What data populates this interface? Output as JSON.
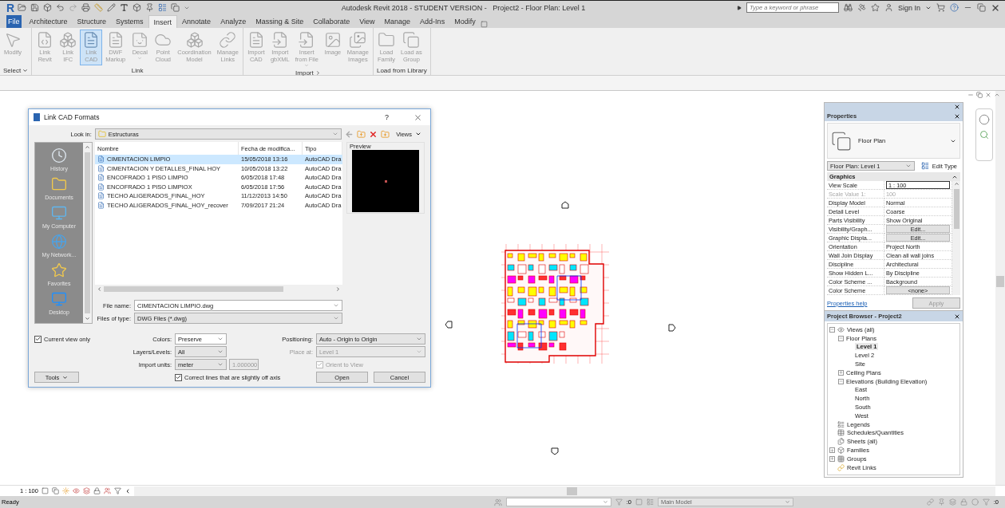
{
  "app_logo": "R",
  "window": {
    "title": "Autodesk Revit 2018 - STUDENT VERSION -   Project2 - Floor Plan: Level 1"
  },
  "search": {
    "placeholder": "Type a keyword or phrase"
  },
  "account": {
    "label": "Sign In"
  },
  "ribbon": {
    "tabs": [
      {
        "label": "File",
        "kind": "app",
        "selected": false
      },
      {
        "label": "Architecture",
        "kind": "tab",
        "selected": false
      },
      {
        "label": "Structure",
        "kind": "tab",
        "selected": false
      },
      {
        "label": "Systems",
        "kind": "tab",
        "selected": false
      },
      {
        "label": "Insert",
        "kind": "tab",
        "selected": true
      },
      {
        "label": "Annotate",
        "kind": "tab",
        "selected": false
      },
      {
        "label": "Analyze",
        "kind": "tab",
        "selected": false
      },
      {
        "label": "Massing & Site",
        "kind": "tab",
        "selected": false
      },
      {
        "label": "Collaborate",
        "kind": "tab",
        "selected": false
      },
      {
        "label": "View",
        "kind": "tab",
        "selected": false
      },
      {
        "label": "Manage",
        "kind": "tab",
        "selected": false
      },
      {
        "label": "Add-Ins",
        "kind": "tab",
        "selected": false
      },
      {
        "label": "Modify",
        "kind": "tab",
        "selected": false
      }
    ],
    "panels": [
      {
        "title": "Select",
        "has_menu": true,
        "launcher": false,
        "tools": [
          {
            "label": "Modify",
            "has_menu": false,
            "selected": false
          }
        ]
      },
      {
        "title": "Link",
        "has_menu": false,
        "launcher": false,
        "tools": [
          {
            "label": "Link\nRevit",
            "has_menu": false,
            "selected": false
          },
          {
            "label": "Link\nIFC",
            "has_menu": false,
            "selected": false
          },
          {
            "label": "Link\nCAD",
            "has_menu": false,
            "selected": true
          },
          {
            "label": "DWF\nMarkup",
            "has_menu": false,
            "selected": false
          },
          {
            "label": "Decal",
            "has_menu": true,
            "selected": false
          },
          {
            "label": "Point\nCloud",
            "has_menu": false,
            "selected": false
          },
          {
            "label": "Coordination\nModel",
            "has_menu": false,
            "selected": false
          },
          {
            "label": "Manage\nLinks",
            "has_menu": false,
            "selected": false
          }
        ]
      },
      {
        "title": "Import",
        "has_menu": false,
        "launcher": true,
        "tools": [
          {
            "label": "Import\nCAD",
            "has_menu": false,
            "selected": false
          },
          {
            "label": "Import\ngbXML",
            "has_menu": false,
            "selected": false
          },
          {
            "label": "Insert\nfrom File",
            "has_menu": true,
            "selected": false
          },
          {
            "label": "Image",
            "has_menu": false,
            "selected": false
          },
          {
            "label": "Manage\nImages",
            "has_menu": false,
            "selected": false
          }
        ]
      },
      {
        "title": "Load from Library",
        "has_menu": false,
        "launcher": false,
        "tools": [
          {
            "label": "Load\nFamily",
            "has_menu": false,
            "selected": false
          },
          {
            "label": "Load as\nGroup",
            "has_menu": false,
            "selected": false
          }
        ]
      }
    ]
  },
  "link_dialog": {
    "title": "Link CAD Formats",
    "help": "?",
    "look_in": {
      "label": "Look in:",
      "value": "Estructuras"
    },
    "views_button": "Views",
    "places": [
      {
        "label": "History"
      },
      {
        "label": "Documents"
      },
      {
        "label": "My Computer"
      },
      {
        "label": "My Network..."
      },
      {
        "label": "Favorites"
      },
      {
        "label": "Desktop"
      }
    ],
    "columns": [
      "Nombre",
      "Fecha de modifica...",
      "Tipo"
    ],
    "files": [
      {
        "name": "CIMENTACION LIMPIO",
        "modified": "15/05/2018 13:16",
        "type": "AutoCAD Dra",
        "selected": true
      },
      {
        "name": "CIMENTACION Y DETALLES_FINAL HOY",
        "modified": "10/05/2018 13:22",
        "type": "AutoCAD Dra",
        "selected": false
      },
      {
        "name": "ENCOFRADO 1 PISO LIMPIO",
        "modified": "6/05/2018 17:48",
        "type": "AutoCAD Dra",
        "selected": false
      },
      {
        "name": "ENCOFRADO 1 PISO LIMPIOX",
        "modified": "6/05/2018 17:56",
        "type": "AutoCAD Dra",
        "selected": false
      },
      {
        "name": "TECHO ALIGERADOS_FINAL_HOY",
        "modified": "11/12/2013 14:50",
        "type": "AutoCAD Dra",
        "selected": false
      },
      {
        "name": "TECHO ALIGERADOS_FINAL_HOY_recover",
        "modified": "7/09/2017 21:24",
        "type": "AutoCAD Dra",
        "selected": false
      }
    ],
    "preview_label": "Preview",
    "file_name": {
      "label": "File name:",
      "value": "CIMENTACION LIMPIO.dwg"
    },
    "file_type": {
      "label": "Files of type:",
      "value": "DWG Files  (*.dwg)"
    },
    "current_view_only": {
      "label": "Current view only",
      "checked": true
    },
    "colors": {
      "label": "Colors:",
      "value": "Preserve"
    },
    "layers": {
      "label": "Layers/Levels:",
      "value": "All"
    },
    "import_units": {
      "label": "Import units:",
      "value": "meter",
      "factor": "1.000000",
      "factor_disabled": true
    },
    "correct_lines": {
      "label": "Correct lines that are slightly off axis",
      "checked": true
    },
    "positioning": {
      "label": "Positioning:",
      "value": "Auto - Origin to Origin",
      "disabled": false
    },
    "place_at": {
      "label": "Place at:",
      "value": "Level 1",
      "disabled": true
    },
    "orient_to_view": {
      "label": "Orient to View",
      "checked": true,
      "disabled": true
    },
    "tools_button": "Tools",
    "open_button": "Open",
    "cancel_button": "Cancel"
  },
  "properties": {
    "title": "Properties",
    "type_name": "Floor Plan",
    "instance": "Floor Plan: Level 1",
    "edit_type": "Edit Type",
    "section": "Graphics",
    "params": [
      {
        "name": "View Scale",
        "value": "1 : 100",
        "kind": "input"
      },
      {
        "name": "Scale Value    1:",
        "value": "100",
        "kind": "readonly"
      },
      {
        "name": "Display Model",
        "value": "Normal",
        "kind": "text"
      },
      {
        "name": "Detail Level",
        "value": "Coarse",
        "kind": "text"
      },
      {
        "name": "Parts Visibility",
        "value": "Show Original",
        "kind": "text"
      },
      {
        "name": "Visibility/Graph...",
        "value": "Edit...",
        "kind": "button"
      },
      {
        "name": "Graphic Displa...",
        "value": "Edit...",
        "kind": "button"
      },
      {
        "name": "Orientation",
        "value": "Project North",
        "kind": "text"
      },
      {
        "name": "Wall Join Display",
        "value": "Clean all wall joins",
        "kind": "text"
      },
      {
        "name": "Discipline",
        "value": "Architectural",
        "kind": "text"
      },
      {
        "name": "Show Hidden L...",
        "value": "By Discipline",
        "kind": "text"
      },
      {
        "name": "Color Scheme ...",
        "value": "Background",
        "kind": "text"
      },
      {
        "name": "Color Scheme",
        "value": "<none>",
        "kind": "button"
      }
    ],
    "help_link": "Properties help",
    "apply": {
      "label": "Apply",
      "disabled": true
    }
  },
  "project_browser": {
    "title": "Project Browser - Project2",
    "tree": [
      {
        "label": "Views (all)",
        "expanded": true,
        "selected": false,
        "children": [
          {
            "label": "Floor Plans",
            "expanded": true,
            "selected": false,
            "children": [
              {
                "label": "Level 1",
                "selected": true
              },
              {
                "label": "Level 2",
                "selected": false
              },
              {
                "label": "Site",
                "selected": false
              }
            ]
          },
          {
            "label": "Ceiling Plans",
            "expanded": false,
            "selected": false
          },
          {
            "label": "Elevations (Building Elevation)",
            "expanded": true,
            "selected": false,
            "children": [
              {
                "label": "East",
                "selected": false
              },
              {
                "label": "North",
                "selected": false
              },
              {
                "label": "South",
                "selected": false
              },
              {
                "label": "West",
                "selected": false
              }
            ]
          }
        ]
      },
      {
        "label": "Legends",
        "selected": false
      },
      {
        "label": "Schedules/Quantities",
        "selected": false
      },
      {
        "label": "Sheets (all)",
        "selected": false
      },
      {
        "label": "Families",
        "expanded": false,
        "selected": false
      },
      {
        "label": "Groups",
        "expanded": false,
        "selected": false
      },
      {
        "label": "Revit Links",
        "selected": false
      }
    ]
  },
  "view_bar": {
    "scale": "1 : 100"
  },
  "status_bar": {
    "message": "Ready",
    "counts": [
      ":0",
      ":0"
    ],
    "model": "Main Model"
  }
}
